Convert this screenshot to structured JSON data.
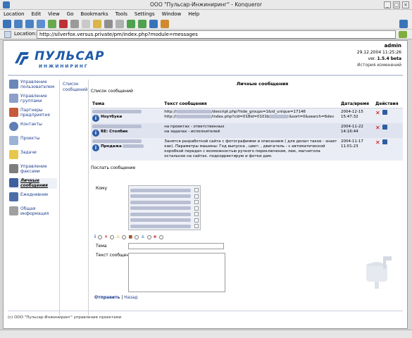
{
  "window": {
    "title": "ООО \"Пульсар-Инжиниринг\" - Konqueror"
  },
  "menu": [
    "Location",
    "Edit",
    "View",
    "Go",
    "Bookmarks",
    "Tools",
    "Settings",
    "Window",
    "Help"
  ],
  "location": {
    "label": "Location:",
    "url": "http://silverfox.versus.private/pm/index.php?module=messages"
  },
  "brand": {
    "name": "ПУЛЬСАР",
    "sub": "ИНЖИНИРИНГ"
  },
  "user": {
    "name": "admin",
    "date": "29.12.2004 11:25:26",
    "version_prefix": "ver.",
    "version": "1.5.4 beta",
    "history": "История изменений"
  },
  "sidebar": [
    {
      "label": "Управление пользователем",
      "icon": "users-icon"
    },
    {
      "label": "Управление группами",
      "icon": "groups-icon"
    },
    {
      "label": "Партнеры предприятия",
      "icon": "partners-icon"
    },
    {
      "label": "Контакты",
      "icon": "contacts-icon"
    },
    {
      "label": "Проекты",
      "icon": "projects-icon"
    },
    {
      "label": "Задачи",
      "icon": "tasks-icon"
    },
    {
      "label": "Управление факсами",
      "icon": "fax-icon"
    },
    {
      "label": "Личные сообщения",
      "icon": "messages-icon",
      "active": true
    },
    {
      "label": "Ежедневник",
      "icon": "calendar-icon"
    },
    {
      "label": "Общая информация",
      "icon": "info-icon"
    }
  ],
  "subnav": {
    "label": "Список сообщений"
  },
  "page": {
    "title": "Личные сообщения",
    "crumb": "Список сообщений"
  },
  "table": {
    "headers": [
      "Тема",
      "Текст сообщения",
      "Дата/время",
      "Действия"
    ],
    "rows": [
      {
        "topic": "Ноутбуки",
        "text1": "http://",
        "text1b": "/descript.php?hide_groups=1&id_unique=17146",
        "text2": "http://",
        "text2b": "/index.php?cid=018id=0101b",
        "text2c": "&sort=0&search=6dev",
        "date": "2004-12-15",
        "time": "15:47:32"
      },
      {
        "topic": "RE: Столбик",
        "text1": "на проектах - ответственных",
        "text2": "на задачах - исполнителей",
        "date": "2004-11-22",
        "time": "14:16:44"
      },
      {
        "topic": "Продажа",
        "text": "Занятся разработкой сайта с фотографиями и описанием ( для делал такое - знает как). Параметры машины: Год выпуска , цвет: , двигатель - с автоматической коробкой передач с возможностью ручного переключения, люк, магнитола остальное на сайтах. подкорректирую и фотки дам.",
        "date": "2004-11-17",
        "time": "11:01:23"
      }
    ]
  },
  "form": {
    "send_title": "Послать сообщение",
    "to_label": "Кому",
    "subject_label": "Тема",
    "body_label": "Текст сообщения",
    "send": "Отправить",
    "sep": "|",
    "back": "Назад"
  },
  "footer": "(c) ООО \"Пульсар-Инжиниринг\" управление проектами",
  "colors": {
    "link": "#1e3f8e",
    "brand": "#1e5aa8",
    "row_a": "#eaedf5",
    "row_b": "#dfe2ef"
  }
}
